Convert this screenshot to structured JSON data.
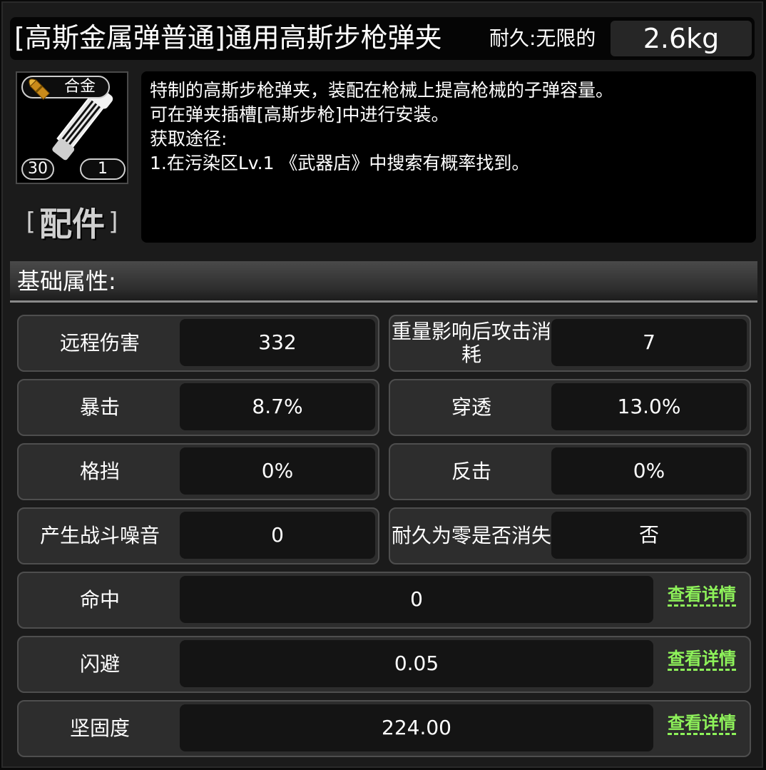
{
  "header": {
    "title": "[高斯金属弹普通]通用高斯步枪弹夹",
    "durability": "耐久:无限的",
    "weight": "2.6kg"
  },
  "item": {
    "material": "合金",
    "count_left": "30",
    "count_right": "1",
    "category_open": "[",
    "category": "配件",
    "category_close": "]"
  },
  "description": {
    "lines": [
      "特制的高斯步枪弹夹，装配在枪械上提高枪械的子弹容量。",
      "可在弹夹插槽[高斯步枪]中进行安装。",
      "获取途径:",
      "1.在污染区Lv.1 《武器店》中搜索有概率找到。"
    ]
  },
  "section": {
    "title": "基础属性:"
  },
  "attributes": {
    "pairs": [
      {
        "left_label": "远程伤害",
        "left_value": "332",
        "right_label": "重量影响后攻击消耗",
        "right_value": "7"
      },
      {
        "left_label": "暴击",
        "left_value": "8.7%",
        "right_label": "穿透",
        "right_value": "13.0%"
      },
      {
        "left_label": "格挡",
        "left_value": "0%",
        "right_label": "反击",
        "right_value": "0%"
      },
      {
        "left_label": "产生战斗噪音",
        "left_value": "0",
        "right_label": "耐久为零是否消失",
        "right_value": "否"
      }
    ],
    "wide": [
      {
        "label": "命中",
        "value": "0",
        "link": "查看详情"
      },
      {
        "label": "闪避",
        "value": "0.05",
        "link": "查看详情"
      },
      {
        "label": "坚固度",
        "value": "224.00",
        "link": "查看详情"
      }
    ]
  },
  "icons": {
    "bullet": "bullet-icon",
    "magazine": "magazine-icon"
  },
  "colors": {
    "link": "#8ef25a",
    "panel": "#2d2d2d",
    "value_bg": "#141414"
  }
}
